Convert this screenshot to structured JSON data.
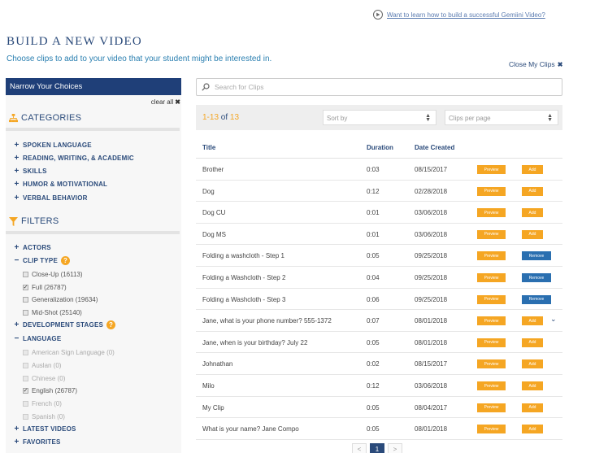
{
  "help_link": {
    "text": "Want to learn how to build a successful Gemiini Video?",
    "icon": "play-circle-icon"
  },
  "header": {
    "title": "BUILD A NEW VIDEO",
    "subtitle": "Choose clips to add to your video that your student might be interested in.",
    "close_clips": "Close My Clips"
  },
  "sidebar": {
    "header": "Narrow Your Choices",
    "clear_all": "clear all",
    "categories_title": "CATEGORIES",
    "categories": [
      "SPOKEN LANGUAGE",
      "READING, WRITING, & ACADEMIC",
      "SKILLS",
      "HUMOR & MOTIVATIONAL",
      "VERBAL BEHAVIOR"
    ],
    "filters_title": "FILTERS",
    "filters": {
      "actors": "ACTORS",
      "clip_type": "CLIP TYPE",
      "clip_type_options": [
        {
          "label": "Close-Up (16113)",
          "checked": false
        },
        {
          "label": "Full (26787)",
          "checked": true
        },
        {
          "label": "Generalization (19634)",
          "checked": false
        },
        {
          "label": "Mid-Shot (25140)",
          "checked": false
        }
      ],
      "development_stages": "DEVELOPMENT STAGES",
      "language": "LANGUAGE",
      "language_options": [
        {
          "label": "American Sign Language (0)",
          "checked": false,
          "disabled": true
        },
        {
          "label": "Auslan (0)",
          "checked": false,
          "disabled": true
        },
        {
          "label": "Chinese (0)",
          "checked": false,
          "disabled": true
        },
        {
          "label": "English (26787)",
          "checked": true,
          "disabled": false
        },
        {
          "label": "French (0)",
          "checked": false,
          "disabled": true
        },
        {
          "label": "Spanish (0)",
          "checked": false,
          "disabled": true
        }
      ],
      "latest_videos": "LATEST VIDEOS",
      "favorites": "FAVORITES"
    }
  },
  "search": {
    "placeholder": "Search for Clips"
  },
  "results": {
    "range": "1-13",
    "of_word": "of",
    "total": "13",
    "sort_placeholder": "Sort by",
    "per_page_placeholder": "Clips per page"
  },
  "table": {
    "columns": [
      "Title",
      "Duration",
      "Date Created"
    ],
    "preview_label": "Preview",
    "add_label": "Add",
    "remove_label": "Remove",
    "rows": [
      {
        "title": "Brother",
        "duration": "0:03",
        "date": "08/15/2017",
        "added": false
      },
      {
        "title": "Dog",
        "duration": "0:12",
        "date": "02/28/2018",
        "added": false
      },
      {
        "title": "Dog CU",
        "duration": "0:01",
        "date": "03/06/2018",
        "added": false
      },
      {
        "title": "Dog MS",
        "duration": "0:01",
        "date": "03/06/2018",
        "added": false
      },
      {
        "title": "Folding a washcloth - Step 1",
        "duration": "0:05",
        "date": "09/25/2018",
        "added": true
      },
      {
        "title": "Folding a Washcloth - Step 2",
        "duration": "0:04",
        "date": "09/25/2018",
        "added": true
      },
      {
        "title": "Folding a Washcloth - Step 3",
        "duration": "0:06",
        "date": "09/25/2018",
        "added": true
      },
      {
        "title": "Jane, what is your phone number? 555-1372",
        "duration": "0:07",
        "date": "08/01/2018",
        "added": false
      },
      {
        "title": "Jane, when is your birthday? July 22",
        "duration": "0:05",
        "date": "08/01/2018",
        "added": false
      },
      {
        "title": "Johnathan",
        "duration": "0:02",
        "date": "08/15/2017",
        "added": false
      },
      {
        "title": "Milo",
        "duration": "0:12",
        "date": "03/06/2018",
        "added": false
      },
      {
        "title": "My Clip",
        "duration": "0:05",
        "date": "08/04/2017",
        "added": false
      },
      {
        "title": "What is your name? Jane Compo",
        "duration": "0:05",
        "date": "08/01/2018",
        "added": false
      }
    ]
  },
  "pagination": {
    "prev": "<",
    "current": "1",
    "next": ">"
  },
  "colors": {
    "navy": "#1f3f78",
    "orange": "#f5a623",
    "blue_button": "#2a6fb0"
  }
}
